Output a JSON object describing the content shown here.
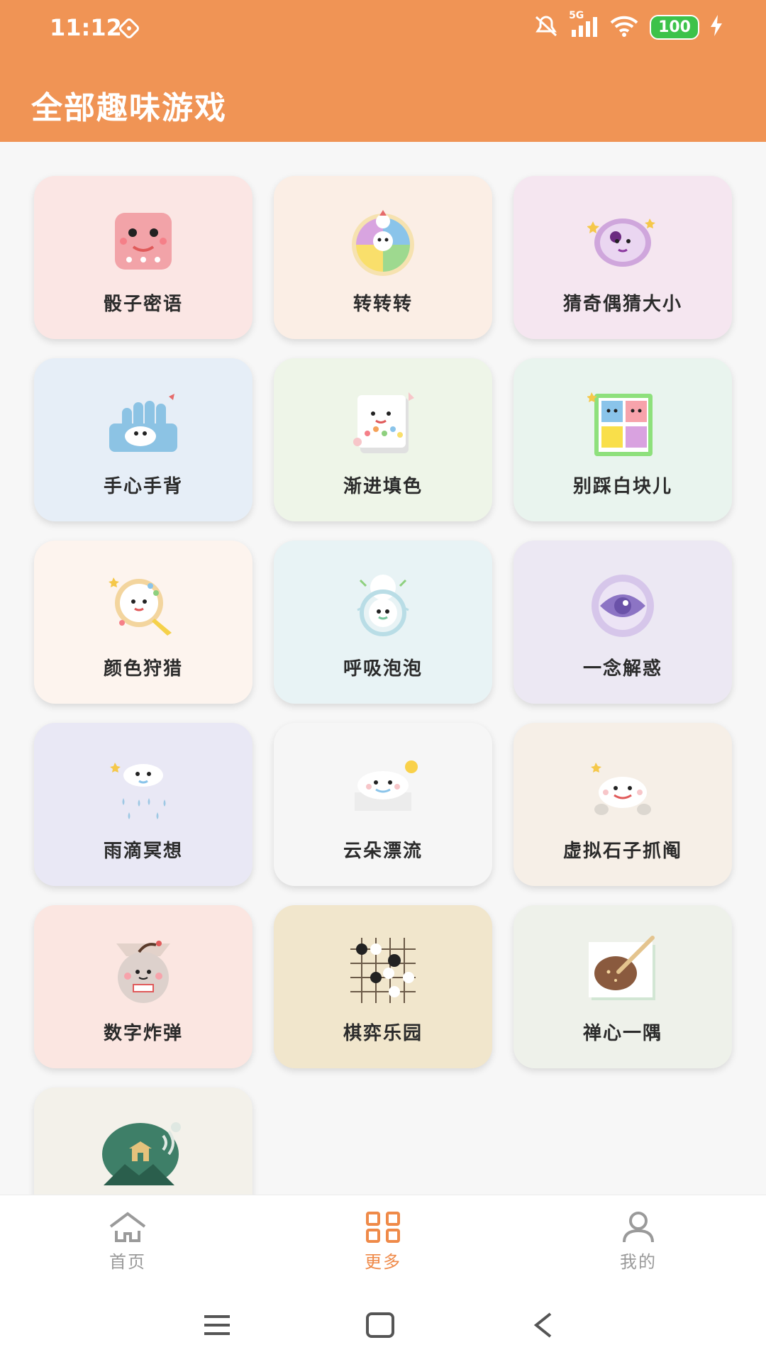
{
  "status_bar": {
    "time": "11:12",
    "network": "5G",
    "battery": "100"
  },
  "header": {
    "title": "全部趣味游戏"
  },
  "games": [
    {
      "label": "骰子密语",
      "icon": "dice-icon",
      "bg": "#fbe6e4"
    },
    {
      "label": "转转转",
      "icon": "spin-wheel-icon",
      "bg": "#fbeee5"
    },
    {
      "label": "猜奇偶猜大小",
      "icon": "odd-even-icon",
      "bg": "#f5e6f0"
    },
    {
      "label": "手心手背",
      "icon": "hand-icon",
      "bg": "#e6eef7"
    },
    {
      "label": "渐进填色",
      "icon": "color-fill-icon",
      "bg": "#eef5e8"
    },
    {
      "label": "别踩白块儿",
      "icon": "tiles-icon",
      "bg": "#e9f4ee"
    },
    {
      "label": "颜色狩猎",
      "icon": "magnifier-icon",
      "bg": "#fdf4ee"
    },
    {
      "label": "呼吸泡泡",
      "icon": "bubble-icon",
      "bg": "#e8f3f5"
    },
    {
      "label": "一念解惑",
      "icon": "eye-icon",
      "bg": "#ece8f3"
    },
    {
      "label": "雨滴冥想",
      "icon": "raindrop-icon",
      "bg": "#e9e8f5"
    },
    {
      "label": "云朵漂流",
      "icon": "cloud-icon",
      "bg": "#f6f6f6"
    },
    {
      "label": "虚拟石子抓阄",
      "icon": "stone-icon",
      "bg": "#f6efe7"
    },
    {
      "label": "数字炸弹",
      "icon": "bomb-icon",
      "bg": "#fbe6e1"
    },
    {
      "label": "棋弈乐园",
      "icon": "chess-board-icon",
      "bg": "#f1e6cc"
    },
    {
      "label": "禅心一隅",
      "icon": "zen-icon",
      "bg": "#eef1ea"
    },
    {
      "label": "",
      "icon": "temple-bubble-icon",
      "bg": "#f3f1ea"
    }
  ],
  "bottom_nav": {
    "items": [
      {
        "label": "首页",
        "icon": "home-icon",
        "active": false
      },
      {
        "label": "更多",
        "icon": "grid-icon",
        "active": true
      },
      {
        "label": "我的",
        "icon": "profile-icon",
        "active": false
      }
    ]
  },
  "colors": {
    "accent": "#f09455",
    "active_nav": "#ef8a49",
    "inactive_nav": "#9a9a9a"
  }
}
